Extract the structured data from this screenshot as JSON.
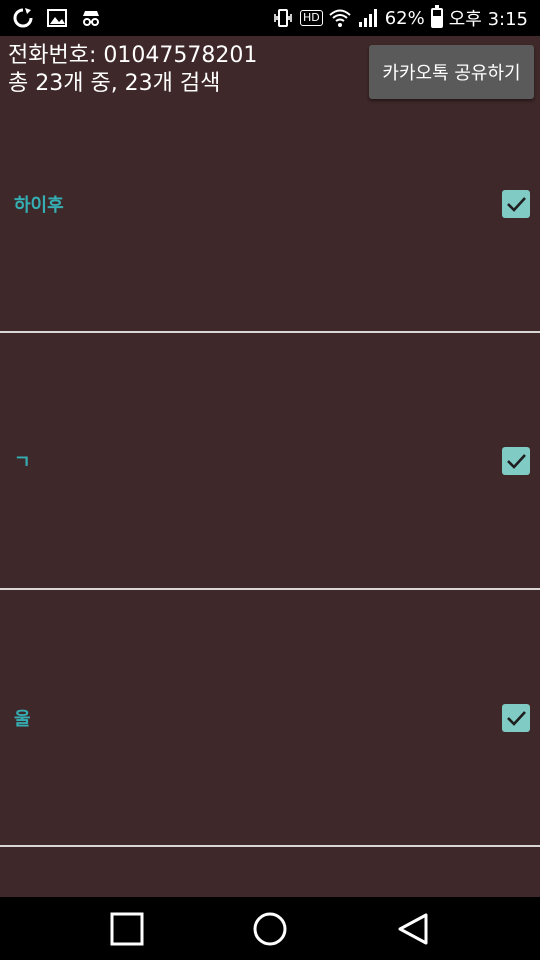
{
  "status_bar": {
    "icons_left": [
      "sync-icon",
      "image-icon",
      "incognito-icon"
    ],
    "icons_right": [
      "vibrate-icon",
      "hd-icon",
      "wifi-icon",
      "signal-icon",
      "battery-icon"
    ],
    "hd_label": "HD",
    "battery_percent_text": "62%",
    "battery_level": 0.62,
    "time": "오후 3:15"
  },
  "header": {
    "phone_line": "전화번호: 01047578201",
    "count_line": "총 23개 중, 23개 검색",
    "share_button_label": "카카오톡 공유하기"
  },
  "list": {
    "items": [
      {
        "name": "하이후",
        "checked": true
      },
      {
        "name": "ㄱ",
        "checked": true
      },
      {
        "name": "울",
        "checked": true
      }
    ]
  },
  "colors": {
    "background": "#3f2829",
    "item_text": "#35aeb3",
    "checkbox": "#80cbc4",
    "divider": "#d9d6d6"
  },
  "nav_bar": {
    "icons": [
      "recent-apps-icon",
      "home-icon",
      "back-icon"
    ]
  }
}
